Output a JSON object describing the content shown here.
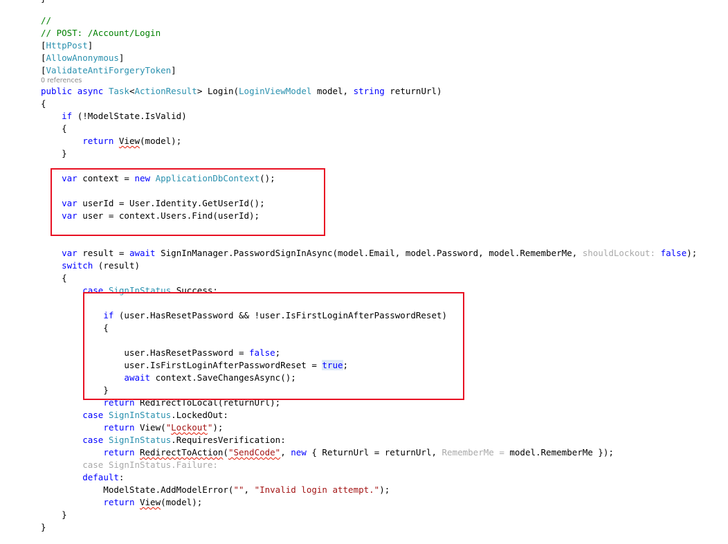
{
  "colors": {
    "keyword": "#0000ff",
    "type": "#2b91af",
    "comment": "#008000",
    "string": "#a31515",
    "faded": "#a9a9a9",
    "highlight_box": "#e81123",
    "squiggle": "#e51400"
  },
  "code": {
    "top_brace": "}",
    "lines": [
      [
        {
          "t": "//",
          "c": "cm"
        }
      ],
      [
        {
          "t": "// POST: /Account/Login",
          "c": "cm"
        }
      ],
      [
        {
          "t": "["
        },
        {
          "t": "HttpPost",
          "c": "ty"
        },
        {
          "t": "]"
        }
      ],
      [
        {
          "t": "["
        },
        {
          "t": "AllowAnonymous",
          "c": "ty"
        },
        {
          "t": "]"
        }
      ],
      [
        {
          "t": "["
        },
        {
          "t": "ValidateAntiForgeryToken",
          "c": "ty"
        },
        {
          "t": "]"
        }
      ],
      [
        {
          "t": "0 references",
          "lens": true
        }
      ],
      [
        {
          "t": "public",
          "c": "kw"
        },
        {
          "t": " "
        },
        {
          "t": "async",
          "c": "kw"
        },
        {
          "t": " "
        },
        {
          "t": "Task",
          "c": "ty"
        },
        {
          "t": "<"
        },
        {
          "t": "ActionResult",
          "c": "ty"
        },
        {
          "t": "> Login("
        },
        {
          "t": "LoginViewModel",
          "c": "ty"
        },
        {
          "t": " model, "
        },
        {
          "t": "string",
          "c": "kw"
        },
        {
          "t": " returnUrl)"
        }
      ],
      [
        {
          "t": "{"
        }
      ],
      [
        {
          "t": "    "
        },
        {
          "t": "if",
          "c": "kw"
        },
        {
          "t": " (!ModelState.IsValid)"
        }
      ],
      [
        {
          "t": "    {"
        }
      ],
      [
        {
          "t": "        "
        },
        {
          "t": "return",
          "c": "kw"
        },
        {
          "t": " "
        },
        {
          "t": "View",
          "sq": true
        },
        {
          "t": "(model);"
        }
      ],
      [
        {
          "t": "    }"
        }
      ],
      [
        {
          "t": ""
        }
      ],
      [
        {
          "t": "    "
        },
        {
          "t": "var",
          "c": "kw"
        },
        {
          "t": " context = "
        },
        {
          "t": "new",
          "c": "kw"
        },
        {
          "t": " "
        },
        {
          "t": "ApplicationDbContext",
          "c": "ty"
        },
        {
          "t": "();"
        }
      ],
      [
        {
          "t": ""
        }
      ],
      [
        {
          "t": "    "
        },
        {
          "t": "var",
          "c": "kw"
        },
        {
          "t": " userId = User.Identity.GetUserId();"
        }
      ],
      [
        {
          "t": "    "
        },
        {
          "t": "var",
          "c": "kw"
        },
        {
          "t": " user = context.Users.Find(userId);"
        }
      ],
      [
        {
          "t": ""
        }
      ],
      [
        {
          "t": ""
        }
      ],
      [
        {
          "t": "    "
        },
        {
          "t": "var",
          "c": "kw"
        },
        {
          "t": " result = "
        },
        {
          "t": "await",
          "c": "kw"
        },
        {
          "t": " SignInManager.PasswordSignInAsync(model.Email, model.Password, model.RememberMe, "
        },
        {
          "t": "shouldLockout:",
          "c": "fade"
        },
        {
          "t": " "
        },
        {
          "t": "false",
          "c": "kw"
        },
        {
          "t": ");"
        }
      ],
      [
        {
          "t": "    "
        },
        {
          "t": "switch",
          "c": "kw"
        },
        {
          "t": " (result)"
        }
      ],
      [
        {
          "t": "    {"
        }
      ],
      [
        {
          "t": "        "
        },
        {
          "t": "case",
          "c": "kw"
        },
        {
          "t": " "
        },
        {
          "t": "SignInStatus",
          "c": "ty"
        },
        {
          "t": ".Success:"
        }
      ],
      [
        {
          "t": ""
        }
      ],
      [
        {
          "t": "            "
        },
        {
          "t": "if",
          "c": "kw"
        },
        {
          "t": " (user.HasResetPassword && !user.IsFirstLoginAfterPasswordReset)"
        }
      ],
      [
        {
          "t": "            {"
        }
      ],
      [
        {
          "t": ""
        }
      ],
      [
        {
          "t": "                user.HasResetPassword = "
        },
        {
          "t": "false",
          "c": "kw"
        },
        {
          "t": ";"
        }
      ],
      [
        {
          "t": "                user.IsFirstLoginAfterPasswordReset = "
        },
        {
          "t": "true",
          "c": "kw",
          "hl": true
        },
        {
          "t": ";"
        }
      ],
      [
        {
          "t": "                "
        },
        {
          "t": "await",
          "c": "kw"
        },
        {
          "t": " context.SaveChangesAsync();"
        }
      ],
      [
        {
          "t": "            }"
        }
      ],
      [
        {
          "t": "            "
        },
        {
          "t": "return",
          "c": "kw"
        },
        {
          "t": " RedirectToLocal(returnUrl);"
        }
      ],
      [
        {
          "t": "        "
        },
        {
          "t": "case",
          "c": "kw"
        },
        {
          "t": " "
        },
        {
          "t": "SignInStatus",
          "c": "ty"
        },
        {
          "t": ".LockedOut:"
        }
      ],
      [
        {
          "t": "            "
        },
        {
          "t": "return",
          "c": "kw"
        },
        {
          "t": " View("
        },
        {
          "t": "\"",
          "c": "str"
        },
        {
          "t": "Lockout",
          "c": "str",
          "sq": true
        },
        {
          "t": "\"",
          "c": "str"
        },
        {
          "t": ");"
        }
      ],
      [
        {
          "t": "        "
        },
        {
          "t": "case",
          "c": "kw"
        },
        {
          "t": " "
        },
        {
          "t": "SignInStatus",
          "c": "ty"
        },
        {
          "t": ".RequiresVerification:"
        }
      ],
      [
        {
          "t": "            "
        },
        {
          "t": "return",
          "c": "kw"
        },
        {
          "t": " "
        },
        {
          "t": "RedirectToAction",
          "sq": true
        },
        {
          "t": "("
        },
        {
          "t": "\"SendCode\"",
          "c": "str",
          "sq": true
        },
        {
          "t": ", "
        },
        {
          "t": "new",
          "c": "kw"
        },
        {
          "t": " { ReturnUrl = returnUrl, "
        },
        {
          "t": "RememberMe =",
          "c": "fade"
        },
        {
          "t": " model.RememberMe });"
        }
      ],
      [
        {
          "t": "        "
        },
        {
          "t": "case SignInStatus.Failure:",
          "c": "fade"
        }
      ],
      [
        {
          "t": "        "
        },
        {
          "t": "default",
          "c": "kw"
        },
        {
          "t": ":"
        }
      ],
      [
        {
          "t": "            ModelState.AddModelError("
        },
        {
          "t": "\"\"",
          "c": "str"
        },
        {
          "t": ", "
        },
        {
          "t": "\"Invalid login attempt.\"",
          "c": "str"
        },
        {
          "t": ");"
        }
      ],
      [
        {
          "t": "            "
        },
        {
          "t": "return",
          "c": "kw"
        },
        {
          "t": " "
        },
        {
          "t": "View",
          "sq": true
        },
        {
          "t": "(model);"
        }
      ],
      [
        {
          "t": "    }"
        }
      ],
      [
        {
          "t": "}"
        }
      ]
    ]
  }
}
